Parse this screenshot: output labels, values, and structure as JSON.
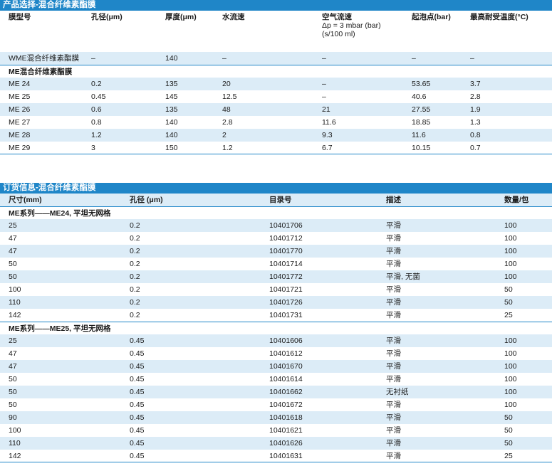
{
  "selection": {
    "title": "产品选择-混合纤维素酯膜",
    "headers": [
      "膜型号",
      "孔径(μm)",
      "厚度(μm)",
      "水流速",
      "空气流速\nΔp = 3 mbar (bar)\n(s/100 ml)",
      "起泡点(bar)",
      "最高耐受温度(°C)"
    ],
    "wme_row": [
      "WME混合纤维素酯膜",
      "–",
      "140",
      "–",
      "–",
      "–",
      "–"
    ],
    "me_subhead": "ME混合纤维素酯膜",
    "rows": [
      [
        "ME 24",
        "0.2",
        "135",
        "20",
        "–",
        "53.65",
        "3.7"
      ],
      [
        "ME 25",
        "0.45",
        "145",
        "12.5",
        "–",
        "40.6",
        "2.8"
      ],
      [
        "ME 26",
        "0.6",
        "135",
        "48",
        "21",
        "27.55",
        "1.9"
      ],
      [
        "ME 27",
        "0.8",
        "140",
        "2.8",
        "11.6",
        "18.85",
        "1.3"
      ],
      [
        "ME 28",
        "1.2",
        "140",
        "2",
        "9.3",
        "11.6",
        "0.8"
      ],
      [
        "ME 29",
        "3",
        "150",
        "1.2",
        "6.7",
        "10.15",
        "0.7"
      ]
    ]
  },
  "ordering": {
    "title": "订货信息-混合纤维素酯膜",
    "headers": [
      "尺寸(mm)",
      "孔径 (μm)",
      "目录号",
      "描述",
      "数量/包"
    ],
    "groups": [
      {
        "label": "ME系列——ME24, 平坦无网格",
        "rows": [
          [
            "25",
            "0.2",
            "10401706",
            "平滑",
            "100"
          ],
          [
            "47",
            "0.2",
            "10401712",
            "平滑",
            "100"
          ],
          [
            "47",
            "0.2",
            "10401770",
            "平滑",
            "100"
          ],
          [
            "50",
            "0.2",
            "10401714",
            "平滑",
            "100"
          ],
          [
            "50",
            "0.2",
            "10401772",
            "平滑, 无菌",
            "100"
          ],
          [
            "100",
            "0.2",
            "10401721",
            "平滑",
            "50"
          ],
          [
            "110",
            "0.2",
            "10401726",
            "平滑",
            "50"
          ],
          [
            "142",
            "0.2",
            "10401731",
            "平滑",
            "25"
          ]
        ]
      },
      {
        "label": "ME系列——ME25, 平坦无网格",
        "rows": [
          [
            "25",
            "0.45",
            "10401606",
            "平滑",
            "100"
          ],
          [
            "47",
            "0.45",
            "10401612",
            "平滑",
            "100"
          ],
          [
            "47",
            "0.45",
            "10401670",
            "平滑",
            "100"
          ],
          [
            "50",
            "0.45",
            "10401614",
            "平滑",
            "100"
          ],
          [
            "50",
            "0.45",
            "10401662",
            "无衬纸",
            "100"
          ],
          [
            "50",
            "0.45",
            "10401672",
            "平滑",
            "100"
          ],
          [
            "90",
            "0.45",
            "10401618",
            "平滑",
            "50"
          ],
          [
            "100",
            "0.45",
            "10401621",
            "平滑",
            "50"
          ],
          [
            "110",
            "0.45",
            "10401626",
            "平滑",
            "50"
          ],
          [
            "142",
            "0.45",
            "10401631",
            "平滑",
            "25"
          ]
        ]
      }
    ]
  }
}
